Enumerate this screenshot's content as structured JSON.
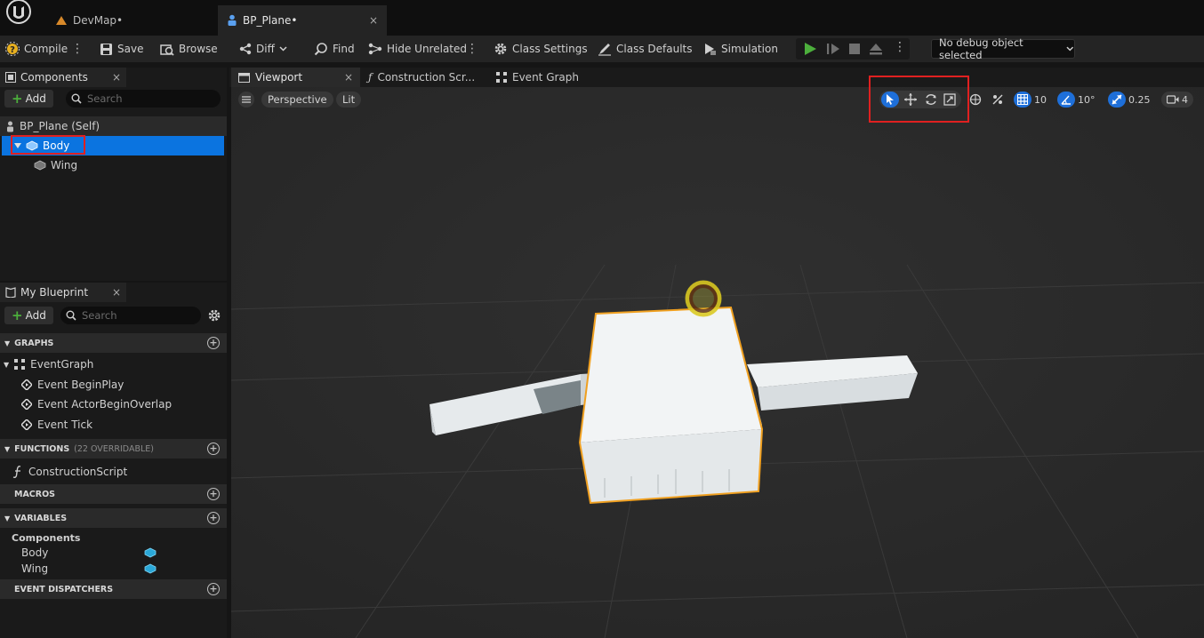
{
  "tabs": {
    "devmap": "DevMap•",
    "bp_plane": "BP_Plane•",
    "close": "×"
  },
  "toolbar": {
    "compile": "Compile",
    "save": "Save",
    "browse": "Browse",
    "diff": "Diff",
    "find": "Find",
    "hide_unrelated": "Hide Unrelated",
    "class_settings": "Class Settings",
    "class_defaults": "Class Defaults",
    "simulation": "Simulation",
    "debug_select": "No debug object selected"
  },
  "components_panel": {
    "title": "Components",
    "add": "Add",
    "search_placeholder": "Search",
    "root": "BP_Plane (Self)",
    "body": "Body",
    "wing": "Wing"
  },
  "blueprint_panel": {
    "title": "My Blueprint",
    "add": "Add",
    "search_placeholder": "Search",
    "graphs": "GRAPHS",
    "event_graph": "EventGraph",
    "events": [
      "Event BeginPlay",
      "Event ActorBeginOverlap",
      "Event Tick"
    ],
    "functions": "FUNCTIONS",
    "functions_note": "(22 OVERRIDABLE)",
    "construction_script": "ConstructionScript",
    "macros": "MACROS",
    "variables": "VARIABLES",
    "components_category": "Components",
    "var_body": "Body",
    "var_wing": "Wing",
    "event_dispatchers": "EVENT DISPATCHERS"
  },
  "editor_tabs": {
    "viewport": "Viewport",
    "construction": "Construction Scr...",
    "event_graph": "Event Graph"
  },
  "viewport_toolbar": {
    "perspective": "Perspective",
    "lit": "Lit",
    "grid_snap": "10",
    "rotation_snap": "10°",
    "scale_snap": "0.25",
    "camera_speed": "4"
  },
  "colors": {
    "accent_blue": "#1e6fd9",
    "selection_blue": "#0b74e0",
    "highlight_red": "#e02020",
    "play_green": "#4caf3c",
    "selection_orange": "#f0a020"
  }
}
